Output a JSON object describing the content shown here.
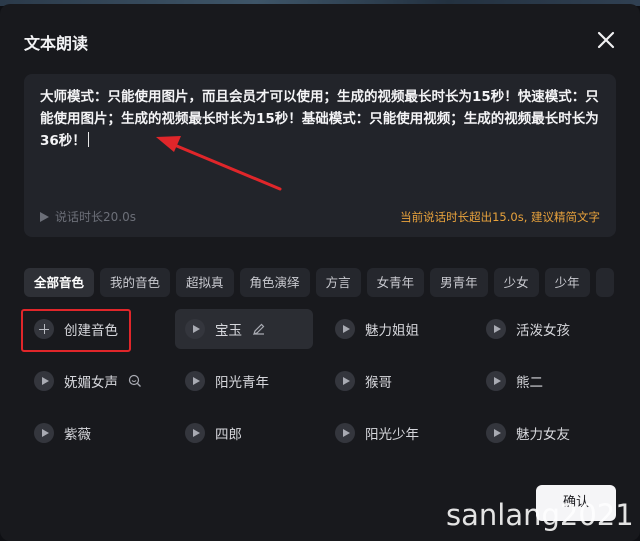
{
  "dialog": {
    "title": "文本朗读",
    "text": "大师模式：只能使用图片，而且会员才可以使用；生成的视频最长时长为15秒！快速模式：只能使用图片；生成的视频最长时长为15秒！基础模式：只能使用视频；生成的视频最长时长为36秒！",
    "preview_label": "说话时长20.0s",
    "warning": "当前说话时长超出15.0s, 建议精简文字",
    "confirm_label": "确认"
  },
  "tabs": [
    {
      "label": "全部音色",
      "active": true
    },
    {
      "label": "我的音色"
    },
    {
      "label": "超拟真"
    },
    {
      "label": "角色演绎"
    },
    {
      "label": "方言"
    },
    {
      "label": "女青年"
    },
    {
      "label": "男青年"
    },
    {
      "label": "少女"
    },
    {
      "label": "少年"
    }
  ],
  "voices": {
    "create_label": "创建音色",
    "items": [
      {
        "label": "宝玉",
        "selected": true
      },
      {
        "label": "魅力姐姐"
      },
      {
        "label": "活泼女孩"
      },
      {
        "label": "妩媚女声"
      },
      {
        "label": "阳光青年"
      },
      {
        "label": "猴哥"
      },
      {
        "label": "熊二"
      },
      {
        "label": "紫薇"
      },
      {
        "label": "四郎"
      },
      {
        "label": "阳光少年"
      },
      {
        "label": "魅力女友"
      }
    ]
  },
  "watermark": "sanlang2021",
  "colors": {
    "accent_warning": "#e8a23c",
    "annotation_red": "#e0262a",
    "dialog_bg": "#18191d"
  }
}
